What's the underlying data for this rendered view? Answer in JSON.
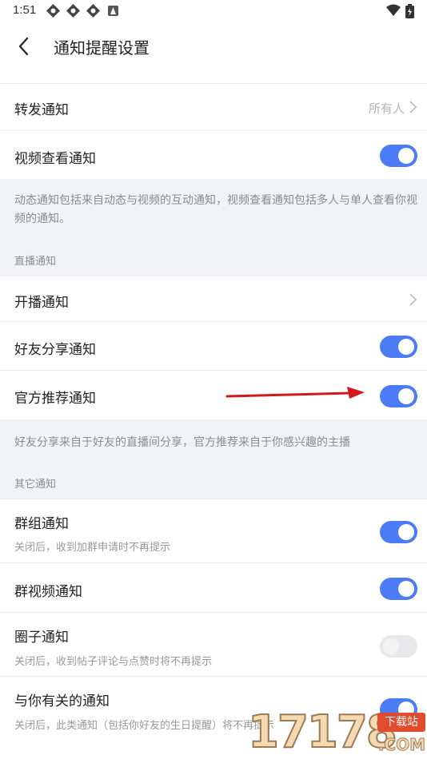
{
  "status_bar": {
    "time": "1:51",
    "icons": [
      "app-icon",
      "app-icon",
      "app-icon",
      "notification-icon"
    ],
    "right_icons": [
      "wifi-icon",
      "battery-icon"
    ]
  },
  "header": {
    "title": "通知提醒设置"
  },
  "group1": {
    "rows": [
      {
        "label": "转发通知",
        "value": "所有人"
      },
      {
        "label": "视频查看通知",
        "toggle": true
      }
    ],
    "note": "动态通知包括来自动态与视频的互动通知，视频查看通知包括多人与单人查看你视频的通知。"
  },
  "live": {
    "section": "直播通知",
    "rows": [
      {
        "label": "开播通知"
      },
      {
        "label": "好友分享通知",
        "toggle": true
      },
      {
        "label": "官方推荐通知",
        "toggle": true
      }
    ],
    "note": "好友分享来自于好友的直播间分享，官方推荐来自于你感兴趣的主播"
  },
  "other": {
    "section": "其它通知",
    "rows": [
      {
        "label": "群组通知",
        "sub": "关闭后，收到加群申请时不再提示",
        "toggle": true
      },
      {
        "label": "群视频通知",
        "toggle": true
      },
      {
        "label": "圈子通知",
        "sub": "关闭后，收到帖子评论与点赞时将不再提示",
        "toggle": false
      },
      {
        "label": "与你有关的通知",
        "sub": "关闭后，此类通知（包括你好友的生日提醒）将不再提示",
        "toggle": true
      }
    ]
  },
  "watermark": {
    "digits": "17178",
    "badge": "下载站",
    "domain": ".COM"
  },
  "colors": {
    "toggle_on": "#4b7cf5",
    "toggle_off": "#e8e8ea",
    "page_bg": "#f2f3f7",
    "arrow": "#d3181b"
  }
}
